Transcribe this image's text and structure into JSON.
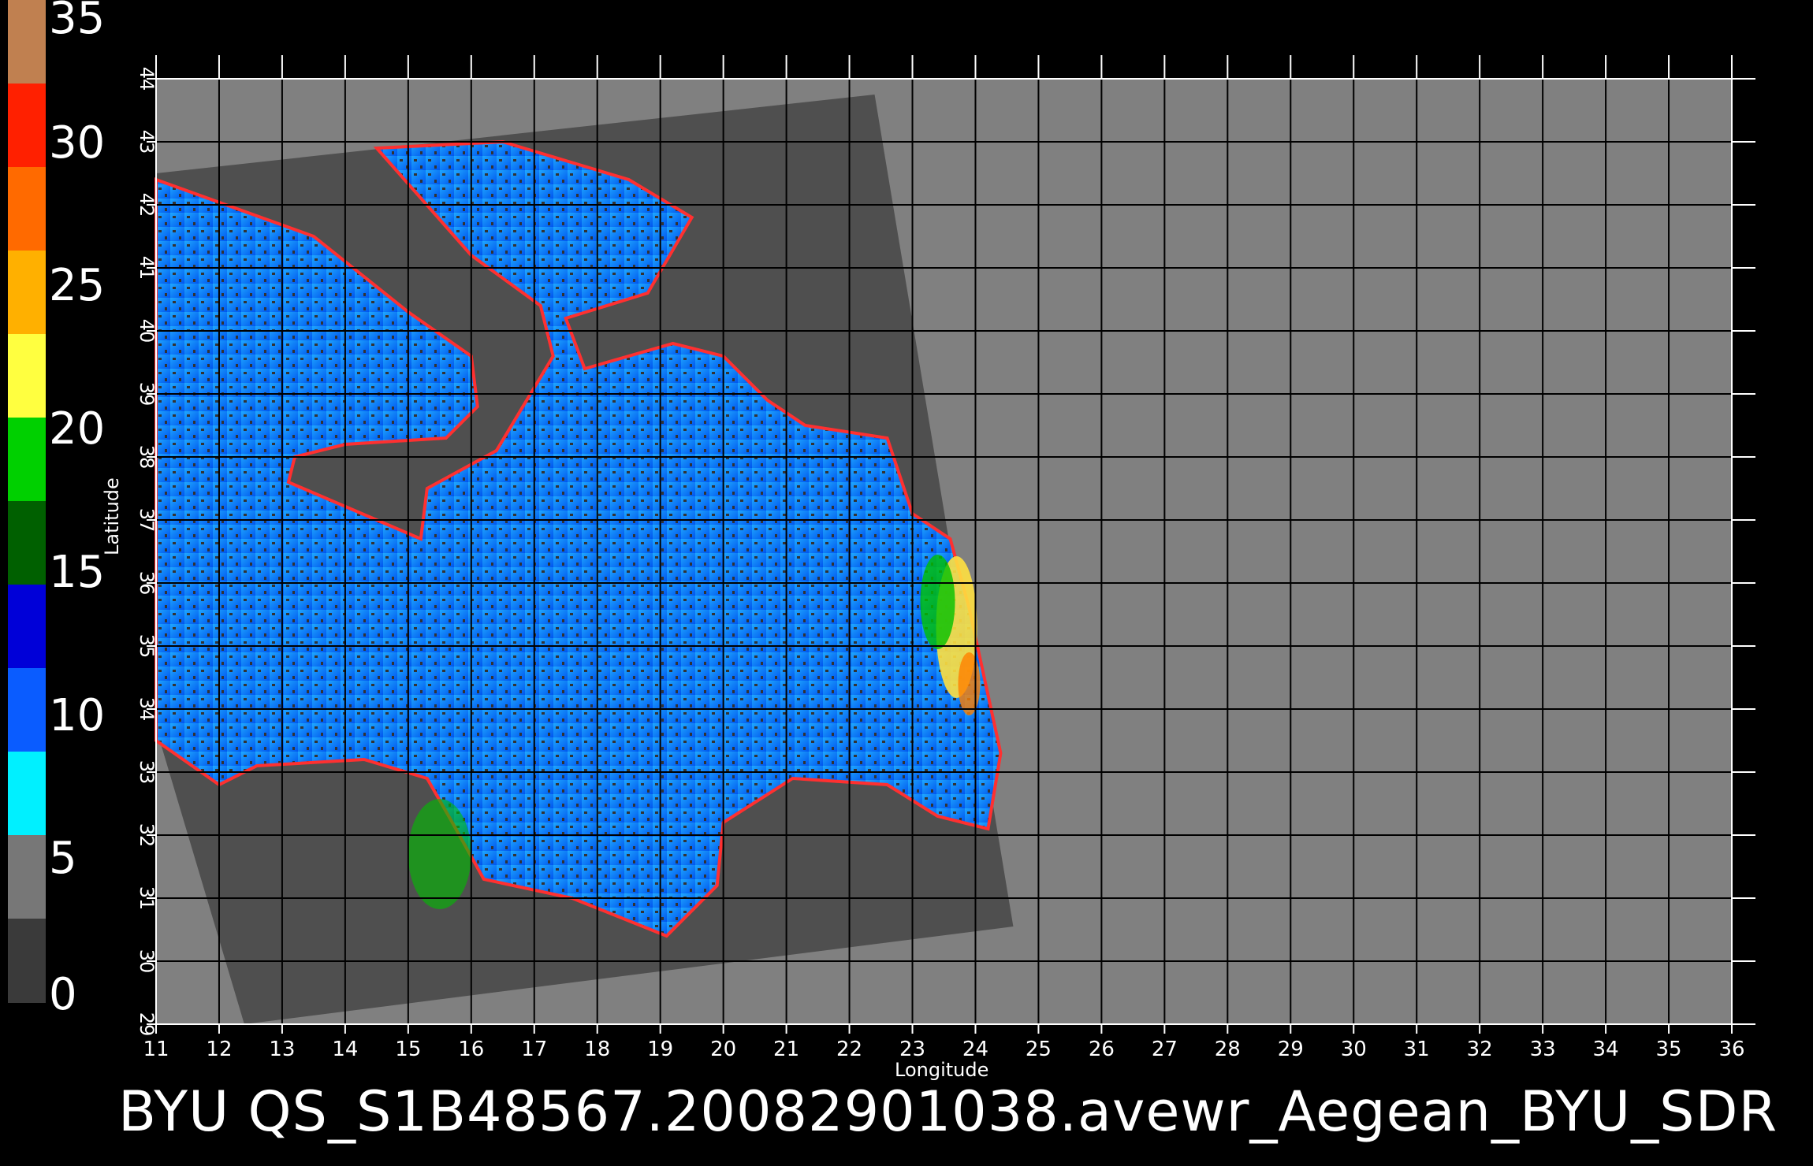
{
  "title": "BYU  QS_S1B48567.20082901038.avewr_Aegean_BYU_SDR",
  "colorbar": {
    "ticks": [
      "0",
      "5",
      "10",
      "15",
      "20",
      "25",
      "30",
      "35"
    ],
    "colors": [
      "#3a3a3a",
      "#777777",
      "#00f0ff",
      "#0a5cff",
      "#0000d8",
      "#006000",
      "#00d000",
      "#ffff40",
      "#ffb000",
      "#ff6a00",
      "#ff2000",
      "#c08050"
    ]
  },
  "axes": {
    "xlabel": "Longitude",
    "ylabel": "Latitude",
    "lon_ticks": [
      "11",
      "12",
      "13",
      "14",
      "15",
      "16",
      "17",
      "18",
      "19",
      "20",
      "21",
      "22",
      "23",
      "24",
      "25",
      "26",
      "27",
      "28",
      "29",
      "30",
      "31",
      "32",
      "33",
      "34",
      "35",
      "36"
    ],
    "lat_ticks": [
      "29",
      "30",
      "31",
      "32",
      "33",
      "34",
      "35",
      "36",
      "37",
      "38",
      "39",
      "40",
      "41",
      "42",
      "43",
      "44"
    ]
  },
  "colors": {
    "background": "#000000",
    "no_data": "#808080",
    "land": "#4f4f4f",
    "sea_low": "#1fa8ff",
    "sea_high": "#0055ee",
    "grid": "#000000"
  }
}
